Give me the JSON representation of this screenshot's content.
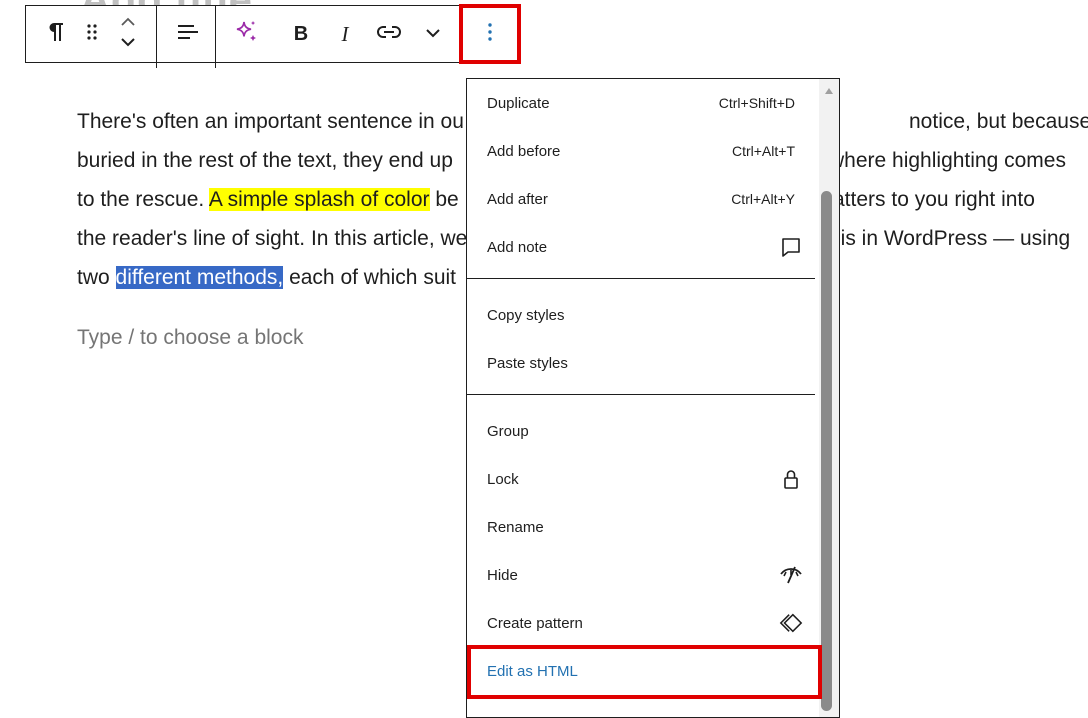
{
  "title_peek": "Add title",
  "toolbar": {
    "paragraph_icon": "pilcrow-icon",
    "drag_icon": "drag-handle-icon",
    "move_icon": "move-up-down-icon",
    "align_icon": "align-icon",
    "ai_icon": "sparkle-icon",
    "bold_icon": "bold-icon",
    "italic_icon": "italic-icon",
    "link_icon": "link-icon",
    "more_formats_icon": "chevron-down-icon",
    "options_icon": "more-vertical-icon",
    "accent_color": "#e00000",
    "ai_color": "#9b2ba8"
  },
  "paragraph": {
    "line1": "There's often an important sentence in ou",
    "line1_end": "notice, but because it's",
    "line2": "buried in the rest of the text, they end up",
    "line2_end": "where highlighting comes",
    "line3_start": "to the rescue. ",
    "line3_highlight": "A simple splash of color",
    "line3_mid": " be",
    "line3_end": "atters to you right into",
    "line4": "the reader's line of sight. In this article, we",
    "line4_end": "his in WordPress — using",
    "line5_start": "two ",
    "line5_selected": "different methods,",
    "line5_end": " each of which suit",
    "highlight_color": "#ffff00",
    "selection_color": "#3769c6"
  },
  "placeholder": "Type / to choose a block",
  "menu": {
    "items": [
      {
        "label": "Duplicate",
        "shortcut": "Ctrl+Shift+D"
      },
      {
        "label": "Add before",
        "shortcut": "Ctrl+Alt+T"
      },
      {
        "label": "Add after",
        "shortcut": "Ctrl+Alt+Y"
      },
      {
        "label": "Add note",
        "icon": "comment-icon"
      },
      {
        "label": "Copy styles"
      },
      {
        "label": "Paste styles"
      },
      {
        "label": "Group"
      },
      {
        "label": "Lock",
        "icon": "lock-icon"
      },
      {
        "label": "Rename"
      },
      {
        "label": "Hide",
        "icon": "hidden-eye-icon"
      },
      {
        "label": "Create pattern",
        "icon": "symbol-icon"
      },
      {
        "label": "Edit as HTML"
      }
    ],
    "edit_html_color": "#2271b1"
  }
}
